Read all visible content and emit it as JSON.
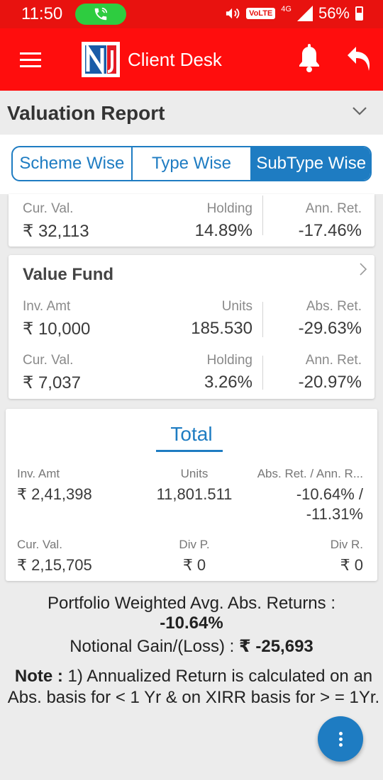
{
  "status_bar": {
    "time": "11:50",
    "volte": "VoLTE",
    "network": "4G",
    "battery": "56%"
  },
  "app_bar": {
    "title": "Client Desk",
    "logo_text": "NJ"
  },
  "report": {
    "title": "Valuation Report"
  },
  "tabs": [
    {
      "label": "Scheme Wise",
      "active": false
    },
    {
      "label": "Type Wise",
      "active": false
    },
    {
      "label": "SubType Wise",
      "active": true
    }
  ],
  "partial_card": {
    "cur_val_label": "Cur. Val.",
    "cur_val": "₹ 32,113",
    "holding_label": "Holding",
    "holding": "14.89%",
    "ann_ret_label": "Ann. Ret.",
    "ann_ret": "-17.46%"
  },
  "value_fund": {
    "name": "Value Fund",
    "inv_amt_label": "Inv. Amt",
    "inv_amt": "₹ 10,000",
    "units_label": "Units",
    "units": "185.530",
    "abs_ret_label": "Abs. Ret.",
    "abs_ret": "-29.63%",
    "cur_val_label": "Cur. Val.",
    "cur_val": "₹ 7,037",
    "holding_label": "Holding",
    "holding": "3.26%",
    "ann_ret_label": "Ann. Ret.",
    "ann_ret": "-20.97%"
  },
  "total": {
    "title": "Total",
    "inv_amt_label": "Inv. Amt",
    "inv_amt": "₹ 2,41,398",
    "units_label": "Units",
    "units": "11,801.511",
    "ret_label": "Abs. Ret. / Ann. R...",
    "ret_line1": "-10.64% /",
    "ret_line2": "-11.31%",
    "cur_val_label": "Cur. Val.",
    "cur_val": "₹ 2,15,705",
    "div_p_label": "Div P.",
    "div_p": "₹ 0",
    "div_r_label": "Div R.",
    "div_r": "₹ 0"
  },
  "summary": {
    "weighted_label": "Portfolio Weighted Avg. Abs. Returns :",
    "weighted_value": "-10.64%",
    "gain_label": "Notional Gain/(Loss) :",
    "gain_value": "₹ -25,693"
  },
  "note": {
    "prefix": "Note :",
    "text": "1) Annualized Return is calculated on an Abs. basis for < 1 Yr & on XIRR basis for > = 1Yr."
  },
  "colors": {
    "primary_red": "#ff0d0d",
    "accent_blue": "#1e7cc2",
    "call_green": "#2ecc40"
  }
}
